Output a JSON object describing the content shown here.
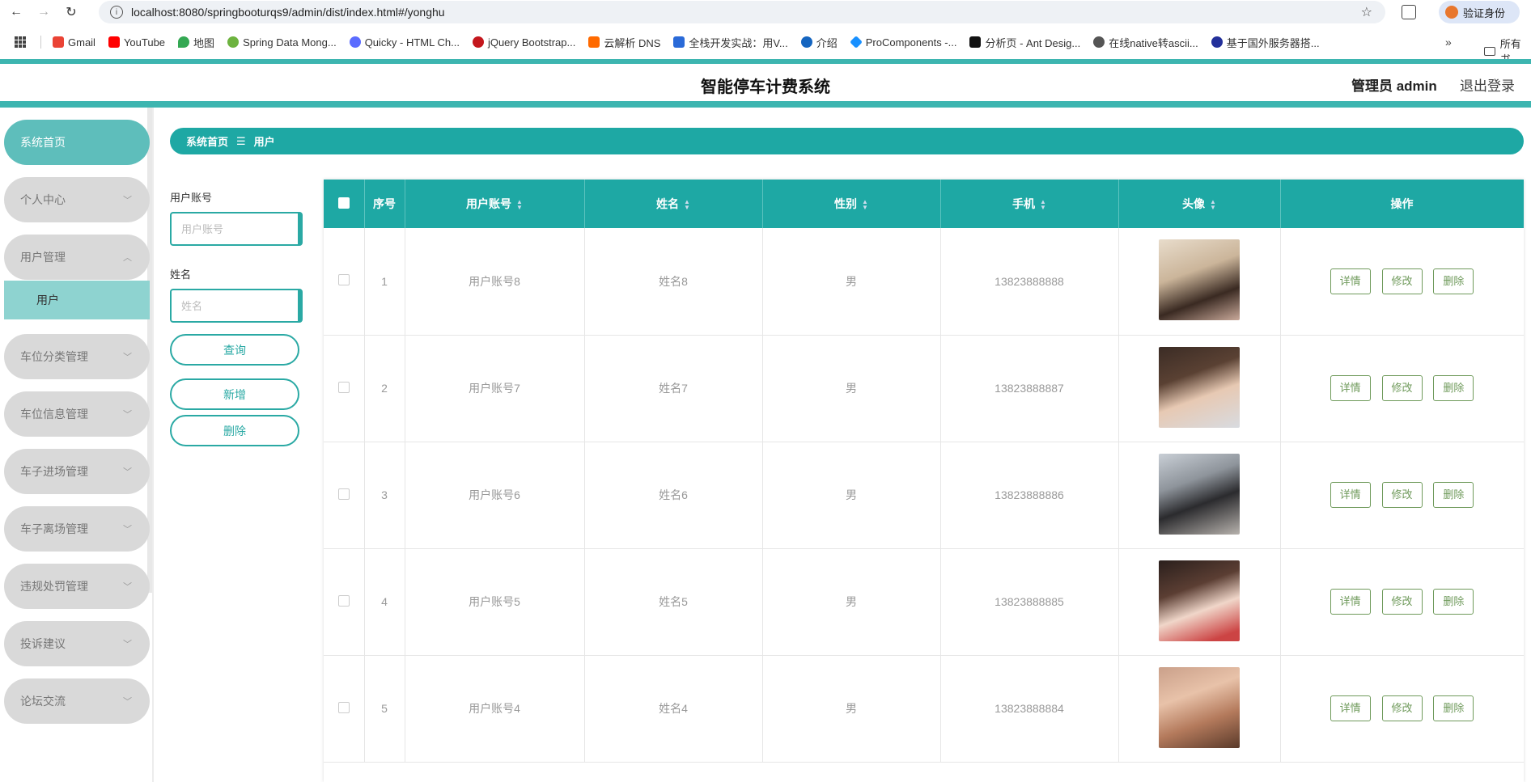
{
  "browser": {
    "url": "localhost:8080/springbooturqs9/admin/dist/index.html#/yonghu",
    "verify_label": "验证身份",
    "bookmarks": [
      "Gmail",
      "YouTube",
      "地图",
      "Spring Data Mong...",
      "Quicky - HTML Ch...",
      "jQuery Bootstrap...",
      "云解析 DNS",
      "全栈开发实战：用V...",
      "介绍",
      "ProComponents -...",
      "分析页 - Ant Desig...",
      "在线native转ascii...",
      "基于国外服务器搭..."
    ],
    "bookmarks_more": "»",
    "bookmarks_folder": "所有书"
  },
  "header": {
    "title": "智能停车计费系统",
    "admin_label": "管理员 admin",
    "logout_label": "退出登录"
  },
  "sidebar": {
    "items": [
      {
        "label": "系统首页"
      },
      {
        "label": "个人中心"
      },
      {
        "label": "用户管理"
      },
      {
        "label": "车位分类管理"
      },
      {
        "label": "车位信息管理"
      },
      {
        "label": "车子进场管理"
      },
      {
        "label": "车子离场管理"
      },
      {
        "label": "违规处罚管理"
      },
      {
        "label": "投诉建议"
      },
      {
        "label": "论坛交流"
      }
    ],
    "sub_item": "用户"
  },
  "breadcrumb": {
    "home": "系统首页",
    "separator": "☰",
    "current": "用户"
  },
  "search": {
    "account_label": "用户账号",
    "account_placeholder": "用户账号",
    "name_label": "姓名",
    "name_placeholder": "姓名",
    "query_btn": "查询",
    "add_btn": "新增",
    "delete_btn": "删除"
  },
  "table": {
    "headers": {
      "index": "序号",
      "account": "用户账号",
      "name": "姓名",
      "gender": "性别",
      "phone": "手机",
      "avatar": "头像",
      "ops": "操作"
    },
    "rows": [
      {
        "index": "1",
        "account": "用户账号8",
        "name": "姓名8",
        "gender": "男",
        "phone": "13823888888"
      },
      {
        "index": "2",
        "account": "用户账号7",
        "name": "姓名7",
        "gender": "男",
        "phone": "13823888887"
      },
      {
        "index": "3",
        "account": "用户账号6",
        "name": "姓名6",
        "gender": "男",
        "phone": "13823888886"
      },
      {
        "index": "4",
        "account": "用户账号5",
        "name": "姓名5",
        "gender": "男",
        "phone": "13823888885"
      },
      {
        "index": "5",
        "account": "用户账号4",
        "name": "姓名4",
        "gender": "男",
        "phone": "13823888884"
      }
    ],
    "ops": {
      "detail": "详情",
      "edit": "修改",
      "delete": "删除"
    }
  },
  "colors": {
    "accent": "#1ea8a4",
    "sidebar_active": "#5ebebb",
    "op_button": "#6f9a5b"
  }
}
